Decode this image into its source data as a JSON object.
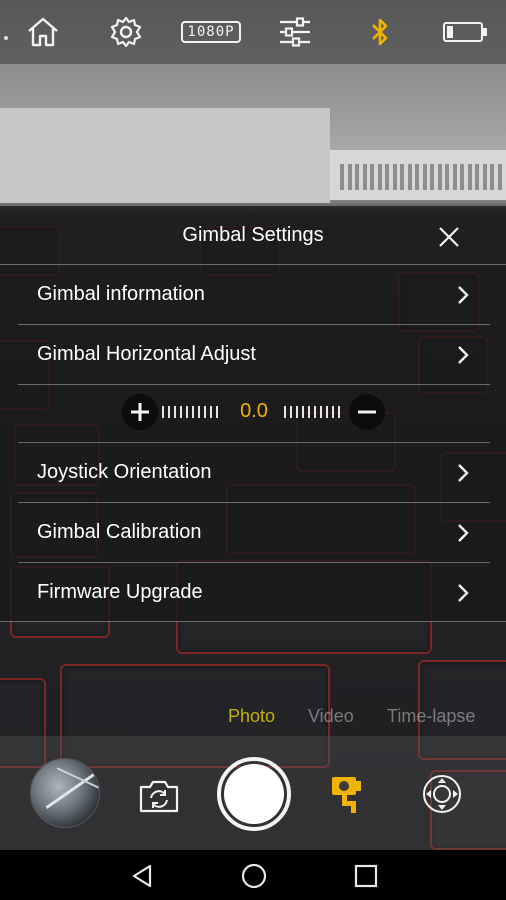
{
  "top_bar": {
    "icons": [
      "home-icon",
      "settings-gear-icon",
      "resolution-badge",
      "sliders-icon",
      "bluetooth-icon",
      "battery-icon"
    ],
    "resolution_label": "1080P",
    "bluetooth_color": "#f0b400"
  },
  "gimbal_panel": {
    "title": "Gimbal Settings",
    "close_icon": "close-icon",
    "items": [
      {
        "label": "Gimbal information"
      },
      {
        "label": "Gimbal Horizontal Adjust"
      },
      {
        "label": "Joystick Orientation"
      },
      {
        "label": "Gimbal Calibration"
      },
      {
        "label": "Firmware Upgrade"
      }
    ],
    "horizontal_adjust": {
      "value": "0.0",
      "value_color": "#f0b400",
      "increase_icon": "plus-icon",
      "decrease_icon": "minus-icon"
    }
  },
  "modes": {
    "items": [
      "Photo",
      "Video",
      "Time-lapse"
    ],
    "selected": "Photo",
    "active_color": "#c4b000"
  },
  "bottom_controls": {
    "icons": [
      "gallery-thumbnail",
      "switch-camera-icon",
      "shutter-button",
      "gimbal-mode-icon",
      "joystick-icon"
    ],
    "gimbal_mode_color": "#f0b400"
  },
  "system_nav": {
    "icons": [
      "back-icon",
      "home-circle-icon",
      "recents-icon"
    ]
  }
}
